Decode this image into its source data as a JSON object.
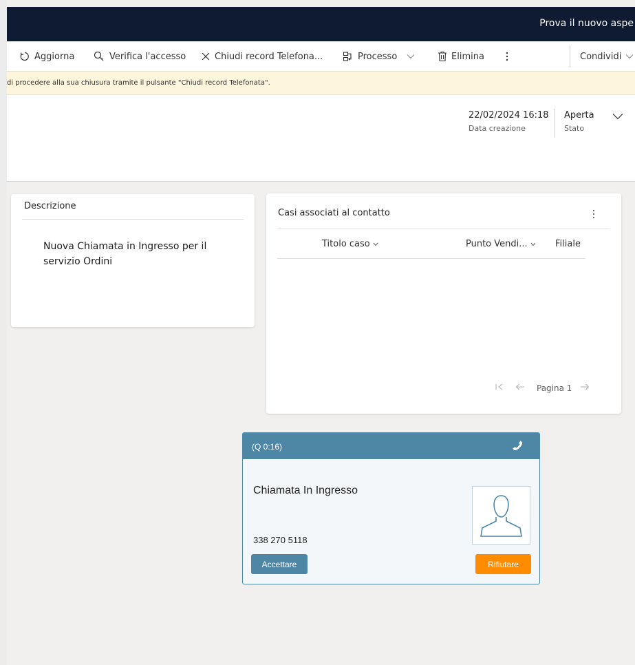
{
  "topbar": {
    "try_new_look": "Prova il nuovo aspe"
  },
  "commands": {
    "refresh": "Aggiorna",
    "check_access": "Verifica l'accesso",
    "close_record": "Chiudi record Telefona...",
    "process": "Processo",
    "delete": "Elimina",
    "share": "Condividi"
  },
  "notification": {
    "text": "di procedere alla sua chiusura tramite il pulsante \"Chiudi record Telefonata\"."
  },
  "header": {
    "created_on_value": "22/02/2024 16:18",
    "created_on_label": "Data creazione",
    "status_value": "Aperta",
    "status_label": "Stato"
  },
  "description_card": {
    "title": "Descrizione",
    "text": "Nuova Chiamata in Ingresso per il servizio Ordini"
  },
  "cases_card": {
    "title": "Casi associati al contatto",
    "columns": [
      "Titolo caso",
      "Punto Vendi...",
      "Filiale"
    ],
    "page_label": "Pagina 1"
  },
  "call_popup": {
    "timer": "(Q 0:16)",
    "title": "Chiamata In Ingresso",
    "phone": "338 270 5118",
    "accept_label": "Accettare",
    "reject_label": "Rifiutare"
  },
  "colors": {
    "topbar": "#0f1b33",
    "notification_bg": "#fdf6dc",
    "popup_accent": "#4e86a6",
    "reject_button": "#ff8c00"
  }
}
